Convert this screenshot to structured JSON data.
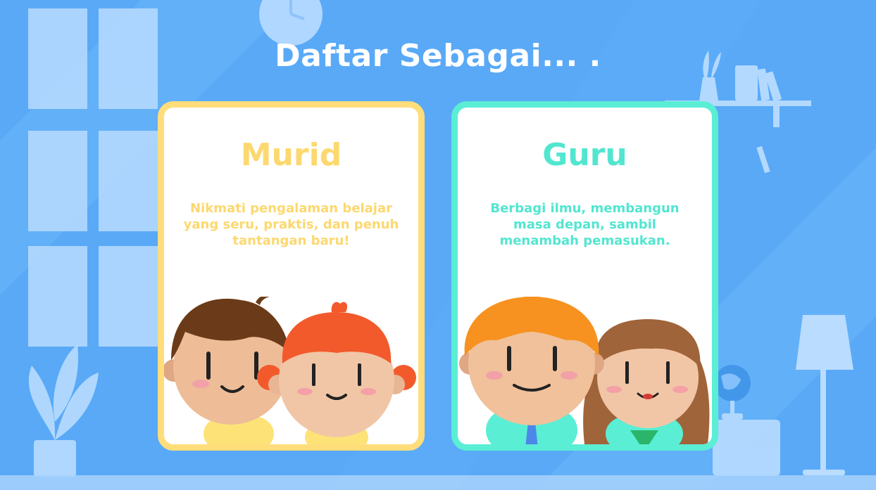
{
  "screen": {
    "title": "Daftar Sebagai... ."
  },
  "roles": [
    {
      "id": "murid",
      "title": "Murid",
      "description": "Nikmati pengalaman belajar yang seru, praktis, dan penuh tantangan baru!",
      "accent": "#ffdd7b"
    },
    {
      "id": "guru",
      "title": "Guru",
      "description": "Berbagi ilmu, membangun masa depan, sambil menambah pemasukan.",
      "accent": "#5aeed5"
    }
  ],
  "colors": {
    "background": "#59a9f7",
    "decor": "#b9dcff",
    "text": "#ffffff"
  }
}
